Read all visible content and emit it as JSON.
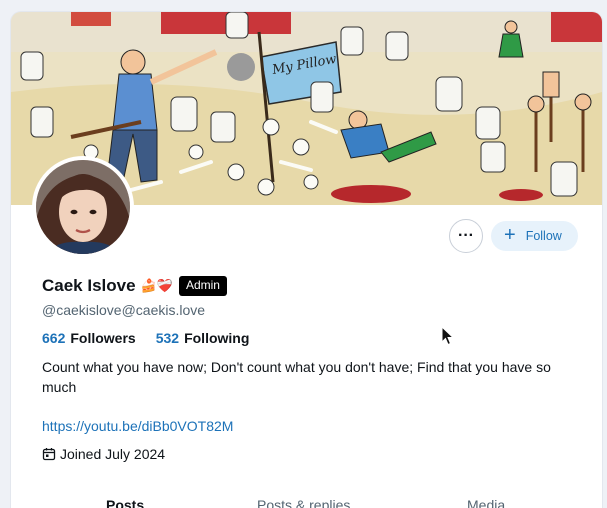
{
  "profile": {
    "display_name": "Caek Islove",
    "emojis": "🍰❤️‍🩹",
    "badge": "Admin",
    "handle": "@caekislove@caekis.love",
    "followers_count": "662",
    "followers_label": "Followers",
    "following_count": "532",
    "following_label": "Following",
    "bio": "Count what you have now; Don't count what you don't have; Find that you have so much",
    "link": "https://youtu.be/diBb0VOT82M",
    "joined": "Joined July 2024"
  },
  "actions": {
    "more_label": "···",
    "follow_label": "Follow"
  },
  "banner": {
    "sign_text": "My Pillow"
  },
  "tabs": [
    "Posts",
    "Posts & replies",
    "Media"
  ],
  "colors": {
    "accent": "#1d72b8",
    "follow_bg": "#e7f2fb",
    "badge_bg": "#000000"
  },
  "icons": [
    "more-icon",
    "plus-icon",
    "calendar-icon",
    "mouse-cursor-icon"
  ]
}
